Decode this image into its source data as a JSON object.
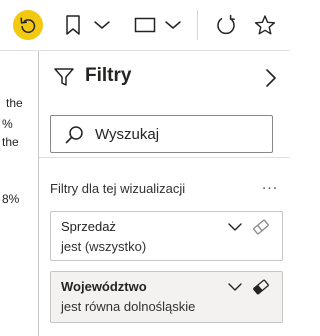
{
  "toolbar": {
    "undo": {
      "icon": "undo-icon",
      "highlight_color": "#f2c811"
    },
    "bookmark": {
      "icon": "bookmark-icon"
    },
    "view": {
      "icon": "view-icon"
    },
    "refresh": {
      "icon": "refresh-icon"
    },
    "favorite": {
      "icon": "star-icon"
    }
  },
  "report_snippet": {
    "lines": [
      "the",
      "%",
      "the",
      "8%"
    ]
  },
  "filters_pane": {
    "title": "Filtry",
    "search": {
      "placeholder": "Wyszukaj",
      "value": ""
    },
    "section_label": "Filtry dla tej wizualizacji",
    "more_label": "...",
    "cards": [
      {
        "name": "Sprzedaż",
        "state": "jest (wszystko)"
      },
      {
        "name": "Województwo",
        "state": "jest równa dolnośląskie"
      }
    ]
  }
}
